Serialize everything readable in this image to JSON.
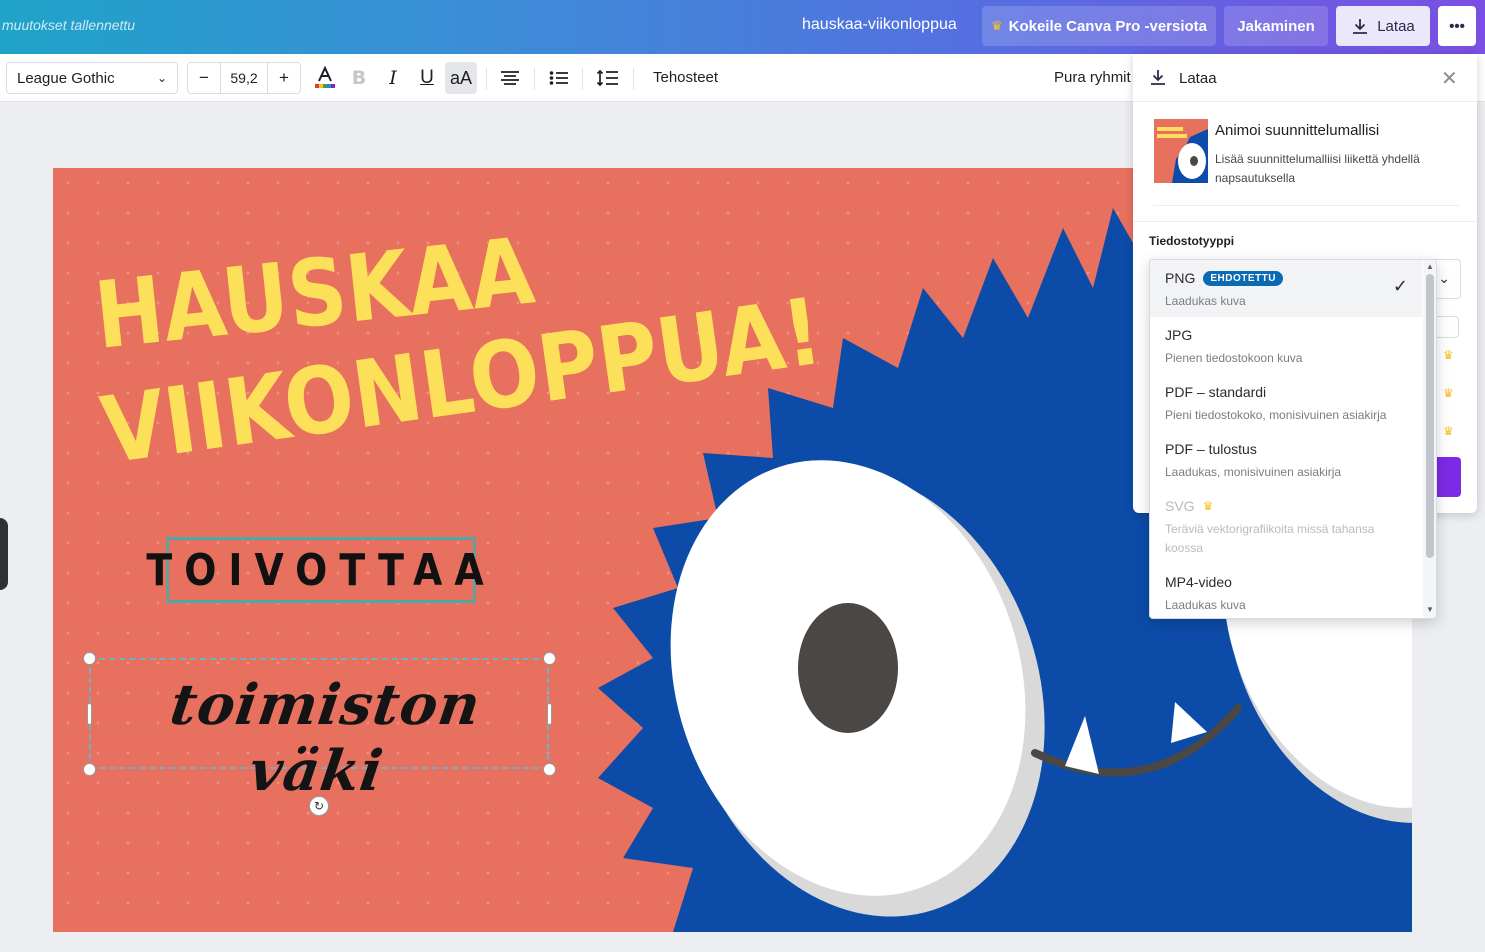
{
  "header": {
    "saved_status": "muutokset tallennettu",
    "doc_title": "hauskaa-viikonloppua",
    "pro_button": "Kokeile Canva Pro -versiota",
    "share_button": "Jakaminen",
    "download_button": "Lataa",
    "more_button": "•••"
  },
  "toolbar": {
    "font_family": "League Gothic",
    "font_size": "59,2",
    "minus": "−",
    "plus": "+",
    "effects": "Tehosteet",
    "ungroup": "Pura ryhmit"
  },
  "design": {
    "headline_line1": "HAUSKAA",
    "headline_line2": "VIIKONLOPPUA!",
    "subtitle": "TOIVOTTAA",
    "script_text": "toimiston väki",
    "colors": {
      "background": "#e8705e",
      "headline": "#fde05a",
      "monster": "#0c4ca8",
      "frame": "#52a6a4"
    }
  },
  "download_panel": {
    "title": "Lataa",
    "animate_title": "Animoi suunnittelumallisi",
    "animate_desc": "Lisää suunnittelumalliisi liikettä yhdellä napsautuksella",
    "filetype_label": "Tiedostotyyppi",
    "accent": "#7d2ae8"
  },
  "filetype_options": [
    {
      "name": "PNG",
      "badge": "EHDOTETTU",
      "desc": "Laadukas kuva",
      "selected": true
    },
    {
      "name": "JPG",
      "desc": "Pienen tiedostokoon kuva"
    },
    {
      "name": "PDF – standardi",
      "desc": "Pieni tiedostokoko, monisivuinen asiakirja"
    },
    {
      "name": "PDF – tulostus",
      "desc": "Laadukas, monisivuinen asiakirja"
    },
    {
      "name": "SVG",
      "desc": "Teräviä vektorigrafiikoita missä tahansa koossa",
      "pro": true,
      "disabled": true
    },
    {
      "name": "MP4-video",
      "desc": "Laadukas kuva"
    }
  ]
}
